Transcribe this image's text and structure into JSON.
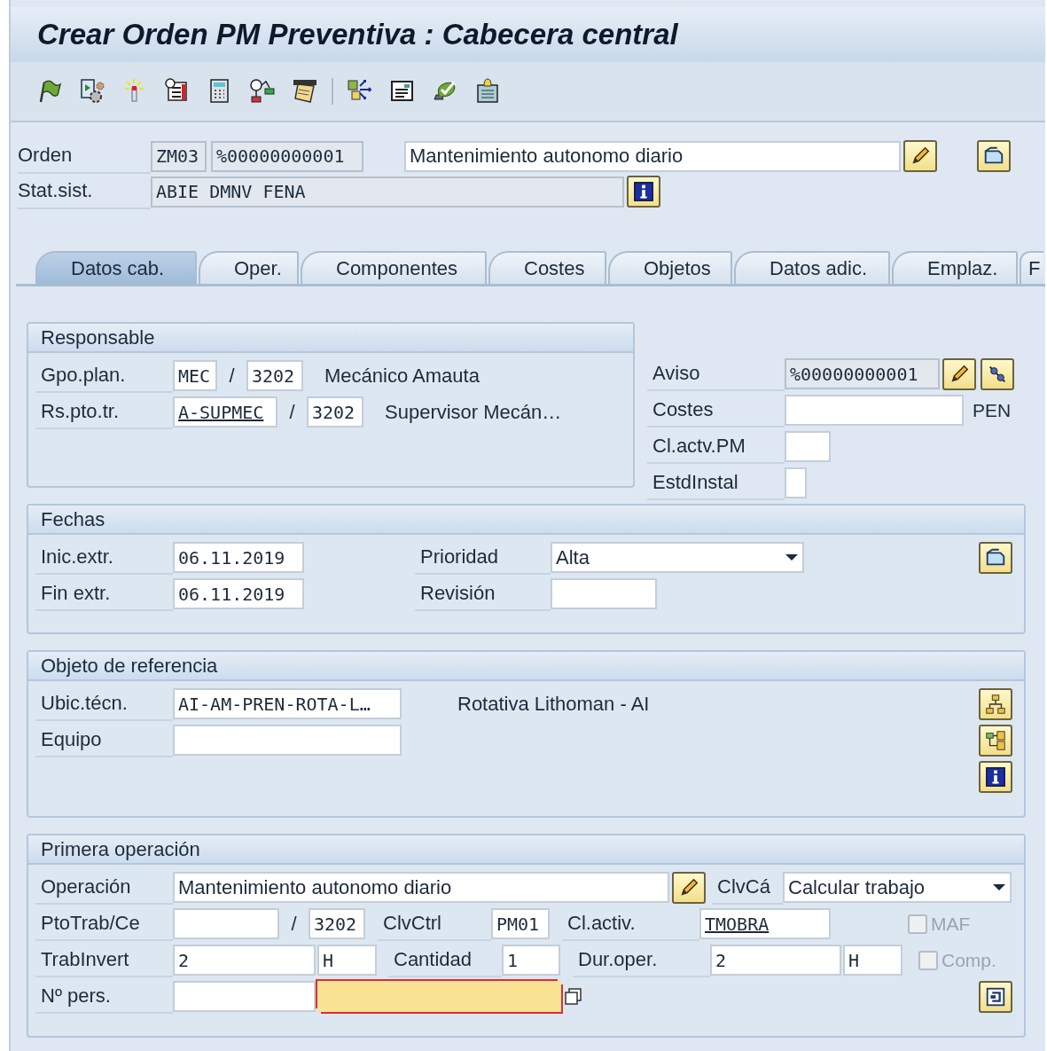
{
  "title": "Crear Orden PM Preventiva : Cabecera central",
  "header": {
    "orden": {
      "label": "Orden",
      "type": "ZM03",
      "number": "%00000000001",
      "description": "Mantenimiento autonomo diario"
    },
    "stat_sist": {
      "label": "Stat.sist.",
      "value": "ABIE DMNV FENA"
    }
  },
  "tabs": [
    {
      "label": "Datos cab.",
      "selected": true
    },
    {
      "label": "Oper.",
      "selected": false
    },
    {
      "label": "Componentes",
      "selected": false
    },
    {
      "label": "Costes",
      "selected": false
    },
    {
      "label": "Objetos",
      "selected": false
    },
    {
      "label": "Datos adic.",
      "selected": false
    },
    {
      "label": "Emplaz.",
      "selected": false
    },
    {
      "label": "F",
      "selected": false
    }
  ],
  "responsable": {
    "title": "Responsable",
    "gpo_plan": {
      "label": "Gpo.plan.",
      "value": "MEC",
      "separator": "/",
      "value_2": "3202",
      "text": "Mecánico Amauta"
    },
    "rs_pto_tr": {
      "label": "Rs.pto.tr.",
      "value": "A-SUPMEC",
      "separator": "/",
      "value_2": "3202",
      "text": "Supervisor Mecán…"
    }
  },
  "side": {
    "aviso": {
      "label": "Aviso",
      "value": "%00000000001"
    },
    "costes": {
      "label": "Costes",
      "currency": "PEN"
    },
    "cl_actv_pm": {
      "label": "Cl.actv.PM"
    },
    "estd_instal": {
      "label": "EstdInstal"
    }
  },
  "fechas": {
    "title": "Fechas",
    "inic_extr": {
      "label": "Inic.extr.",
      "value": "06.11.2019"
    },
    "fin_extr": {
      "label": "Fin extr.",
      "value": "06.11.2019"
    },
    "prioridad": {
      "label": "Prioridad",
      "value": "Alta"
    },
    "revision": {
      "label": "Revisión"
    }
  },
  "objeto": {
    "title": "Objeto de referencia",
    "ubic_tecn": {
      "label": "Ubic.técn.",
      "value": "AI-AM-PREN-ROTA-L…",
      "text": "Rotativa Lithoman - AI"
    },
    "equipo": {
      "label": "Equipo"
    }
  },
  "primera": {
    "title": "Primera operación",
    "operacion": {
      "label": "Operación",
      "value": "Mantenimiento autonomo diario"
    },
    "clvca": {
      "label": "ClvCá",
      "value": "Calcular trabajo"
    },
    "pto_trab": {
      "label": "PtoTrab/Ce",
      "separator": "/",
      "value_2": "3202"
    },
    "clvctrl": {
      "label": "ClvCtrl",
      "value": "PM01"
    },
    "cl_activ": {
      "label": "Cl.activ.",
      "value": "TMOBRA"
    },
    "maf": {
      "label": "MAF",
      "checked": false,
      "disabled": true
    },
    "trab_invert": {
      "label": "TrabInvert",
      "value": "2",
      "unit": "H"
    },
    "cantidad": {
      "label": "Cantidad",
      "value": "1"
    },
    "dur_oper": {
      "label": "Dur.oper.",
      "value": "2",
      "unit": "H"
    },
    "comp": {
      "label": "Comp.",
      "checked": false,
      "disabled": true
    },
    "n_pers": {
      "label": "Nº pers.",
      "required_highlight": true
    }
  }
}
